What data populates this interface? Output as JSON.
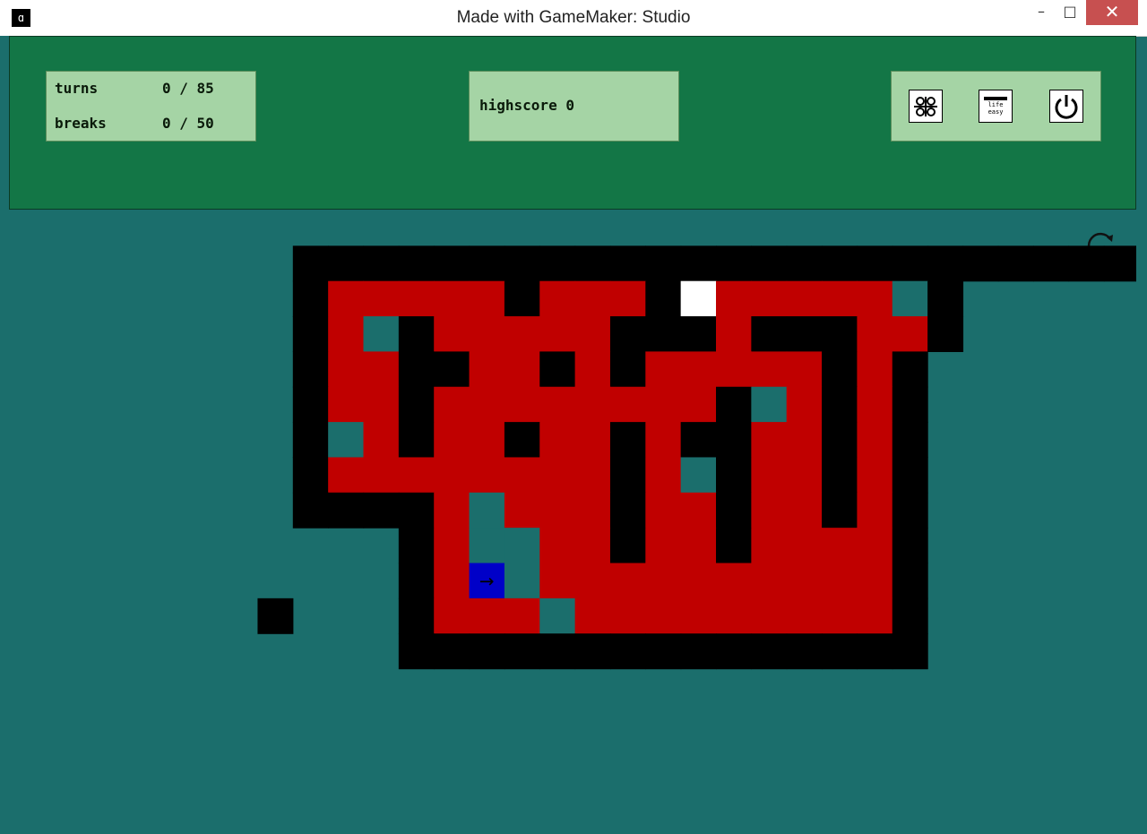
{
  "window": {
    "title": "Made with GameMaker: Studio",
    "minimize_glyph": "–",
    "maximize_glyph": "□",
    "close_glyph": "✕"
  },
  "hud": {
    "turns": {
      "label": "turns",
      "value": "0 / 85"
    },
    "breaks": {
      "label": "breaks",
      "value": "0 / 50"
    },
    "highscore": {
      "label": "highscore",
      "value": "0"
    },
    "tools": [
      {
        "name": "controls-icon"
      },
      {
        "name": "life-easy-icon",
        "text_line1": "life",
        "text_line2": "easy"
      },
      {
        "name": "power-icon"
      }
    ]
  },
  "board": {
    "cols": 32,
    "rows": 18,
    "colors": {
      "background": "#1b6e6c",
      "wall": "#000000",
      "floor": "#c00000",
      "teal": "#1b6e6c",
      "white": "#ffffff",
      "player": "#0000c8"
    },
    "legend": {
      "W": "wall",
      "R": "floor",
      "T": "teal",
      "H": "white",
      "P": "player",
      ".": "background"
    },
    "grid": [
      "................................",
      "........WWWWWWWWWWWWWWWWWWWWWWWW",
      "........WRRRRRWRRRWHRRRRRTW.....",
      "........WRTWRRRRRWWWRWWWRRW.....",
      "........WRRWWRRWRWRRRRRWRW......",
      "........WRRWRRRRRRRRWTRWRW......",
      "........WTRWRRWRRWRWWRRWRW......",
      "........WRRRRRRRRWRTWRRWRW......",
      "........WWWWRTRRRWRRWRRWRW......",
      "...........WRTTRRWRRWRRRRW......",
      "...........WRPTRRRRRRRRRRW......",
      ".......W...WRRRTRRRRRRRRRW......",
      "...........WWWWWWWWWWWWWWW......",
      "................................",
      "................................",
      "................................",
      "................................",
      "................................"
    ],
    "player": {
      "col": 13,
      "row": 10,
      "direction": "right",
      "arrow": "→"
    }
  }
}
